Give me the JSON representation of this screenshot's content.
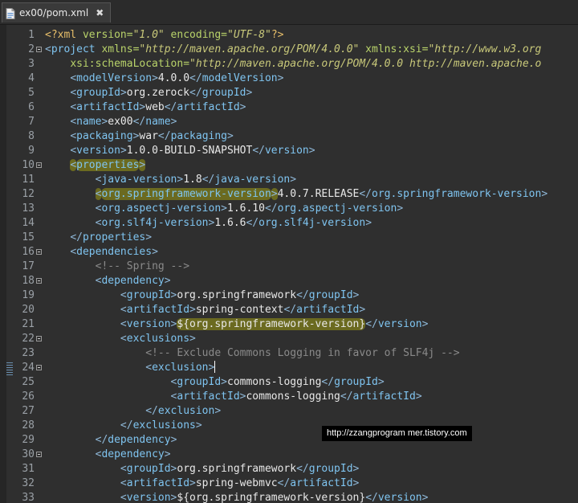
{
  "tab": {
    "title": "ex00/pom.xml",
    "close": "✖"
  },
  "watermark": "http://zzangprogram mer.tistory.com",
  "lines": [
    {
      "n": "1",
      "fold": false,
      "marker": false,
      "segs": [
        [
          "pi",
          "<?xml "
        ],
        [
          "attr",
          "version="
        ],
        [
          "val",
          "\"1.0\""
        ],
        [
          "attr",
          " encoding="
        ],
        [
          "val",
          "\"UTF-8\""
        ],
        [
          "pi",
          "?>"
        ]
      ]
    },
    {
      "n": "2",
      "fold": true,
      "marker": false,
      "segs": [
        [
          "punct",
          "<"
        ],
        [
          "tag",
          "project"
        ],
        [
          "attr",
          " xmlns="
        ],
        [
          "val",
          "\"http://maven.apache.org/POM/4.0.0\""
        ],
        [
          "attr",
          " xmlns:xsi="
        ],
        [
          "val",
          "\"http://www.w3.org"
        ]
      ]
    },
    {
      "n": "3",
      "fold": false,
      "marker": false,
      "segs": [
        [
          "text",
          "    "
        ],
        [
          "attr",
          "xsi:schemaLocation="
        ],
        [
          "val",
          "\"http://maven.apache.org/POM/4.0.0 http://maven.apache.o"
        ]
      ]
    },
    {
      "n": "4",
      "fold": false,
      "marker": false,
      "segs": [
        [
          "text",
          "    "
        ],
        [
          "punct",
          "<"
        ],
        [
          "tag",
          "modelVersion"
        ],
        [
          "punct",
          ">"
        ],
        [
          "text",
          "4.0.0"
        ],
        [
          "punct",
          "</"
        ],
        [
          "tag",
          "modelVersion"
        ],
        [
          "punct",
          ">"
        ]
      ]
    },
    {
      "n": "5",
      "fold": false,
      "marker": false,
      "segs": [
        [
          "text",
          "    "
        ],
        [
          "punct",
          "<"
        ],
        [
          "tag",
          "groupId"
        ],
        [
          "punct",
          ">"
        ],
        [
          "text",
          "org.zerock"
        ],
        [
          "punct",
          "</"
        ],
        [
          "tag",
          "groupId"
        ],
        [
          "punct",
          ">"
        ]
      ]
    },
    {
      "n": "6",
      "fold": false,
      "marker": false,
      "segs": [
        [
          "text",
          "    "
        ],
        [
          "punct",
          "<"
        ],
        [
          "tag",
          "artifactId"
        ],
        [
          "punct",
          ">"
        ],
        [
          "text",
          "web"
        ],
        [
          "punct",
          "</"
        ],
        [
          "tag",
          "artifactId"
        ],
        [
          "punct",
          ">"
        ]
      ]
    },
    {
      "n": "7",
      "fold": false,
      "marker": false,
      "segs": [
        [
          "text",
          "    "
        ],
        [
          "punct",
          "<"
        ],
        [
          "tag",
          "name"
        ],
        [
          "punct",
          ">"
        ],
        [
          "text",
          "ex00"
        ],
        [
          "punct",
          "</"
        ],
        [
          "tag",
          "name"
        ],
        [
          "punct",
          ">"
        ]
      ]
    },
    {
      "n": "8",
      "fold": false,
      "marker": false,
      "segs": [
        [
          "text",
          "    "
        ],
        [
          "punct",
          "<"
        ],
        [
          "tag",
          "packaging"
        ],
        [
          "punct",
          ">"
        ],
        [
          "text",
          "war"
        ],
        [
          "punct",
          "</"
        ],
        [
          "tag",
          "packaging"
        ],
        [
          "punct",
          ">"
        ]
      ]
    },
    {
      "n": "9",
      "fold": false,
      "marker": false,
      "segs": [
        [
          "text",
          "    "
        ],
        [
          "punct",
          "<"
        ],
        [
          "tag",
          "version"
        ],
        [
          "punct",
          ">"
        ],
        [
          "text",
          "1.0.0-BUILD-SNAPSHOT"
        ],
        [
          "punct",
          "</"
        ],
        [
          "tag",
          "version"
        ],
        [
          "punct",
          ">"
        ]
      ]
    },
    {
      "n": "10",
      "fold": true,
      "marker": false,
      "segs": [
        [
          "text",
          "    "
        ],
        [
          "punct hl",
          "<"
        ],
        [
          "tag hl",
          "properties"
        ],
        [
          "punct hl",
          ">"
        ]
      ]
    },
    {
      "n": "11",
      "fold": false,
      "marker": false,
      "segs": [
        [
          "text",
          "        "
        ],
        [
          "punct",
          "<"
        ],
        [
          "tag",
          "java-version"
        ],
        [
          "punct",
          ">"
        ],
        [
          "text",
          "1.8"
        ],
        [
          "punct",
          "</"
        ],
        [
          "tag",
          "java-version"
        ],
        [
          "punct",
          ">"
        ]
      ]
    },
    {
      "n": "12",
      "fold": false,
      "marker": false,
      "segs": [
        [
          "text",
          "        "
        ],
        [
          "punct hl",
          "<"
        ],
        [
          "tag hl",
          "org.springframework-version"
        ],
        [
          "punct hl",
          ">"
        ],
        [
          "text",
          "4.0.7.RELEASE"
        ],
        [
          "punct",
          "</"
        ],
        [
          "tag",
          "org.springframework-version"
        ],
        [
          "punct",
          ">"
        ]
      ]
    },
    {
      "n": "13",
      "fold": false,
      "marker": false,
      "segs": [
        [
          "text",
          "        "
        ],
        [
          "punct",
          "<"
        ],
        [
          "tag",
          "org.aspectj-version"
        ],
        [
          "punct",
          ">"
        ],
        [
          "text",
          "1.6.10"
        ],
        [
          "punct",
          "</"
        ],
        [
          "tag",
          "org.aspectj-version"
        ],
        [
          "punct",
          ">"
        ]
      ]
    },
    {
      "n": "14",
      "fold": false,
      "marker": false,
      "segs": [
        [
          "text",
          "        "
        ],
        [
          "punct",
          "<"
        ],
        [
          "tag",
          "org.slf4j-version"
        ],
        [
          "punct",
          ">"
        ],
        [
          "text",
          "1.6.6"
        ],
        [
          "punct",
          "</"
        ],
        [
          "tag",
          "org.slf4j-version"
        ],
        [
          "punct",
          ">"
        ]
      ]
    },
    {
      "n": "15",
      "fold": false,
      "marker": false,
      "segs": [
        [
          "text",
          "    "
        ],
        [
          "punct",
          "</"
        ],
        [
          "tag",
          "properties"
        ],
        [
          "punct",
          ">"
        ]
      ]
    },
    {
      "n": "16",
      "fold": true,
      "marker": false,
      "segs": [
        [
          "text",
          "    "
        ],
        [
          "punct",
          "<"
        ],
        [
          "tag",
          "dependencies"
        ],
        [
          "punct",
          ">"
        ]
      ]
    },
    {
      "n": "17",
      "fold": false,
      "marker": false,
      "segs": [
        [
          "text",
          "        "
        ],
        [
          "comment",
          "<!-- Spring -->"
        ]
      ]
    },
    {
      "n": "18",
      "fold": true,
      "marker": false,
      "segs": [
        [
          "text",
          "        "
        ],
        [
          "punct",
          "<"
        ],
        [
          "tag",
          "dependency"
        ],
        [
          "punct",
          ">"
        ]
      ]
    },
    {
      "n": "19",
      "fold": false,
      "marker": false,
      "segs": [
        [
          "text",
          "            "
        ],
        [
          "punct",
          "<"
        ],
        [
          "tag",
          "groupId"
        ],
        [
          "punct",
          ">"
        ],
        [
          "text",
          "org.springframework"
        ],
        [
          "punct",
          "</"
        ],
        [
          "tag",
          "groupId"
        ],
        [
          "punct",
          ">"
        ]
      ]
    },
    {
      "n": "20",
      "fold": false,
      "marker": false,
      "segs": [
        [
          "text",
          "            "
        ],
        [
          "punct",
          "<"
        ],
        [
          "tag",
          "artifactId"
        ],
        [
          "punct",
          ">"
        ],
        [
          "text",
          "spring-context"
        ],
        [
          "punct",
          "</"
        ],
        [
          "tag",
          "artifactId"
        ],
        [
          "punct",
          ">"
        ]
      ]
    },
    {
      "n": "21",
      "fold": false,
      "marker": false,
      "segs": [
        [
          "text",
          "            "
        ],
        [
          "punct",
          "<"
        ],
        [
          "tag",
          "version"
        ],
        [
          "punct",
          ">"
        ],
        [
          "text hl",
          "${org.springframework-version}"
        ],
        [
          "punct",
          "</"
        ],
        [
          "tag",
          "version"
        ],
        [
          "punct",
          ">"
        ]
      ]
    },
    {
      "n": "22",
      "fold": true,
      "marker": false,
      "segs": [
        [
          "text",
          "            "
        ],
        [
          "punct",
          "<"
        ],
        [
          "tag",
          "exclusions"
        ],
        [
          "punct",
          ">"
        ]
      ]
    },
    {
      "n": "23",
      "fold": false,
      "marker": false,
      "segs": [
        [
          "text",
          "                "
        ],
        [
          "comment",
          "<!-- Exclude Commons Logging in favor of SLF4j -->"
        ]
      ]
    },
    {
      "n": "24",
      "fold": true,
      "marker": true,
      "cursor": true,
      "segs": [
        [
          "text",
          "                "
        ],
        [
          "punct",
          "<"
        ],
        [
          "tag",
          "exclusion"
        ],
        [
          "punct",
          ">"
        ]
      ]
    },
    {
      "n": "25",
      "fold": false,
      "marker": false,
      "segs": [
        [
          "text",
          "                    "
        ],
        [
          "punct",
          "<"
        ],
        [
          "tag",
          "groupId"
        ],
        [
          "punct",
          ">"
        ],
        [
          "text",
          "commons-logging"
        ],
        [
          "punct",
          "</"
        ],
        [
          "tag",
          "groupId"
        ],
        [
          "punct",
          ">"
        ]
      ]
    },
    {
      "n": "26",
      "fold": false,
      "marker": false,
      "segs": [
        [
          "text",
          "                    "
        ],
        [
          "punct",
          "<"
        ],
        [
          "tag",
          "artifactId"
        ],
        [
          "punct",
          ">"
        ],
        [
          "text",
          "commons-logging"
        ],
        [
          "punct",
          "</"
        ],
        [
          "tag",
          "artifactId"
        ],
        [
          "punct",
          ">"
        ]
      ]
    },
    {
      "n": "27",
      "fold": false,
      "marker": false,
      "segs": [
        [
          "text",
          "                "
        ],
        [
          "punct",
          "</"
        ],
        [
          "tag",
          "exclusion"
        ],
        [
          "punct",
          ">"
        ]
      ]
    },
    {
      "n": "28",
      "fold": false,
      "marker": false,
      "segs": [
        [
          "text",
          "            "
        ],
        [
          "punct",
          "</"
        ],
        [
          "tag",
          "exclusions"
        ],
        [
          "punct",
          ">"
        ]
      ]
    },
    {
      "n": "29",
      "fold": false,
      "marker": false,
      "segs": [
        [
          "text",
          "        "
        ],
        [
          "punct",
          "</"
        ],
        [
          "tag",
          "dependency"
        ],
        [
          "punct",
          ">"
        ]
      ]
    },
    {
      "n": "30",
      "fold": true,
      "marker": false,
      "segs": [
        [
          "text",
          "        "
        ],
        [
          "punct",
          "<"
        ],
        [
          "tag",
          "dependency"
        ],
        [
          "punct",
          ">"
        ]
      ]
    },
    {
      "n": "31",
      "fold": false,
      "marker": false,
      "segs": [
        [
          "text",
          "            "
        ],
        [
          "punct",
          "<"
        ],
        [
          "tag",
          "groupId"
        ],
        [
          "punct",
          ">"
        ],
        [
          "text",
          "org.springframework"
        ],
        [
          "punct",
          "</"
        ],
        [
          "tag",
          "groupId"
        ],
        [
          "punct",
          ">"
        ]
      ]
    },
    {
      "n": "32",
      "fold": false,
      "marker": false,
      "segs": [
        [
          "text",
          "            "
        ],
        [
          "punct",
          "<"
        ],
        [
          "tag",
          "artifactId"
        ],
        [
          "punct",
          ">"
        ],
        [
          "text",
          "spring-webmvc"
        ],
        [
          "punct",
          "</"
        ],
        [
          "tag",
          "artifactId"
        ],
        [
          "punct",
          ">"
        ]
      ]
    },
    {
      "n": "33",
      "fold": false,
      "marker": false,
      "segs": [
        [
          "text",
          "            "
        ],
        [
          "punct",
          "<"
        ],
        [
          "tag",
          "version"
        ],
        [
          "punct",
          ">"
        ],
        [
          "text",
          "${org.springframework-version}"
        ],
        [
          "punct",
          "</"
        ],
        [
          "tag",
          "version"
        ],
        [
          "punct",
          ">"
        ]
      ]
    }
  ]
}
